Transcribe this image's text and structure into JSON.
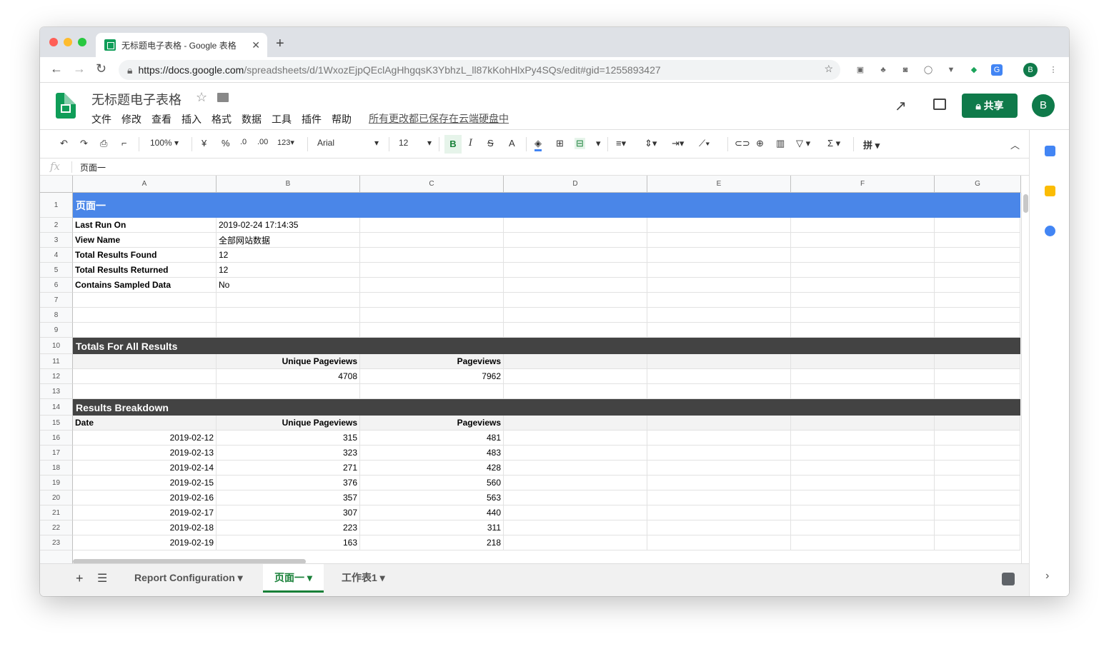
{
  "browser": {
    "tab_title": "无标题电子表格 - Google 表格",
    "url_host": "https://docs.google.com",
    "url_path": "/spreadsheets/d/1WxozEjpQEclAgHhgqsK3YbhzL_ll87kKohHlxPy4SQs/edit#gid=1255893427",
    "profile_initial": "B"
  },
  "doc": {
    "title": "无标题电子表格",
    "menu": [
      "文件",
      "修改",
      "查看",
      "插入",
      "格式",
      "数据",
      "工具",
      "插件",
      "帮助"
    ],
    "saved_status": "所有更改都已保存在云端硬盘中",
    "share_label": "共享",
    "avatar_initial": "B"
  },
  "toolbar": {
    "zoom": "100%",
    "currency": "¥",
    "percent": "%",
    "dec_less": ".0",
    "dec_more": ".00",
    "more_formats": "123",
    "font": "Arial",
    "font_size": "12"
  },
  "formula_bar": {
    "value": "页面一"
  },
  "columns": [
    "A",
    "B",
    "C",
    "D",
    "E",
    "F",
    "G"
  ],
  "rows": [
    {
      "n": "1",
      "band": "页面一",
      "band_color": "#4a86e8"
    },
    {
      "n": "2",
      "a": "Last Run On",
      "b": "2019-02-24 17:14:35"
    },
    {
      "n": "3",
      "a": "View Name",
      "b": "全部网站数据"
    },
    {
      "n": "4",
      "a": "Total Results Found",
      "b": "12"
    },
    {
      "n": "5",
      "a": "Total Results Returned",
      "b": "12"
    },
    {
      "n": "6",
      "a": "Contains Sampled Data",
      "b": "No"
    },
    {
      "n": "7"
    },
    {
      "n": "8"
    },
    {
      "n": "9"
    },
    {
      "n": "10",
      "band": "Totals For All Results",
      "band_color": "#434343"
    },
    {
      "n": "11",
      "b": "Unique Pageviews",
      "c": "Pageviews",
      "hdr": true
    },
    {
      "n": "12",
      "b": "4708",
      "c": "7962",
      "num": true
    },
    {
      "n": "13"
    },
    {
      "n": "14",
      "band": "Results Breakdown",
      "band_color": "#434343"
    },
    {
      "n": "15",
      "a": "Date",
      "b": "Unique Pageviews",
      "c": "Pageviews",
      "hdr": true
    },
    {
      "n": "16",
      "a": "2019-02-12",
      "b": "315",
      "c": "481",
      "num": true
    },
    {
      "n": "17",
      "a": "2019-02-13",
      "b": "323",
      "c": "483",
      "num": true
    },
    {
      "n": "18",
      "a": "2019-02-14",
      "b": "271",
      "c": "428",
      "num": true
    },
    {
      "n": "19",
      "a": "2019-02-15",
      "b": "376",
      "c": "560",
      "num": true
    },
    {
      "n": "20",
      "a": "2019-02-16",
      "b": "357",
      "c": "563",
      "num": true
    },
    {
      "n": "21",
      "a": "2019-02-17",
      "b": "307",
      "c": "440",
      "num": true
    },
    {
      "n": "22",
      "a": "2019-02-18",
      "b": "223",
      "c": "311",
      "num": true
    },
    {
      "n": "23",
      "a": "2019-02-19",
      "b": "163",
      "c": "218",
      "num": true
    }
  ],
  "sheet_tabs": [
    {
      "label": "Report Configuration",
      "active": false
    },
    {
      "label": "页面一",
      "active": true
    },
    {
      "label": "工作表1",
      "active": false
    }
  ]
}
